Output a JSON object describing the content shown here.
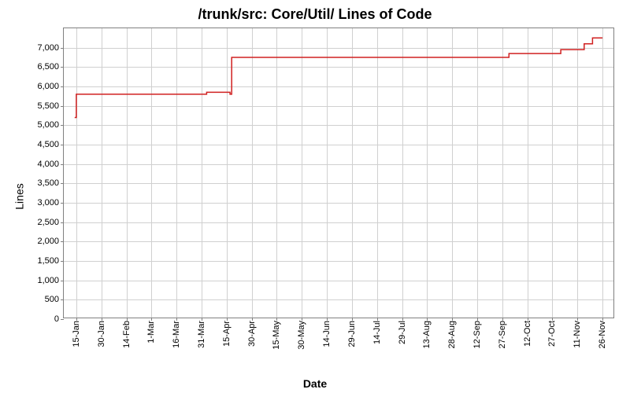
{
  "chart_data": {
    "type": "line",
    "title": "/trunk/src: Core/Util/ Lines of Code",
    "xlabel": "Date",
    "ylabel": "Lines",
    "ylim": [
      0,
      7500
    ],
    "y_ticks": [
      0,
      500,
      1000,
      1500,
      2000,
      2500,
      3000,
      3500,
      4000,
      4500,
      5000,
      5500,
      6000,
      6500,
      7000
    ],
    "y_tick_labels": [
      "0",
      "500",
      "1,000",
      "1,500",
      "2,000",
      "2,500",
      "3,000",
      "3,500",
      "4,000",
      "4,500",
      "5,000",
      "5,500",
      "6,000",
      "6,500",
      "7,000"
    ],
    "x_tick_labels": [
      "15-Jan",
      "30-Jan",
      "14-Feb",
      "1-Mar",
      "16-Mar",
      "31-Mar",
      "15-Apr",
      "30-Apr",
      "15-May",
      "30-May",
      "14-Jun",
      "29-Jun",
      "14-Jul",
      "29-Jul",
      "13-Aug",
      "28-Aug",
      "12-Sep",
      "27-Sep",
      "12-Oct",
      "27-Oct",
      "11-Nov",
      "26-Nov"
    ],
    "series": [
      {
        "name": "Lines of Code",
        "color": "#d02020",
        "points": [
          {
            "x": "14-Jan",
            "y": 5200
          },
          {
            "x": "15-Jan",
            "y": 5800
          },
          {
            "x": "31-Mar",
            "y": 5800
          },
          {
            "x": "3-Apr",
            "y": 5850
          },
          {
            "x": "17-Apr",
            "y": 5800
          },
          {
            "x": "18-Apr",
            "y": 6750
          },
          {
            "x": "30-Sep",
            "y": 6750
          },
          {
            "x": "1-Oct",
            "y": 6850
          },
          {
            "x": "30-Oct",
            "y": 6850
          },
          {
            "x": "1-Nov",
            "y": 6950
          },
          {
            "x": "14-Nov",
            "y": 6950
          },
          {
            "x": "15-Nov",
            "y": 7100
          },
          {
            "x": "19-Nov",
            "y": 7100
          },
          {
            "x": "20-Nov",
            "y": 7250
          },
          {
            "x": "26-Nov",
            "y": 7250
          }
        ]
      }
    ]
  }
}
